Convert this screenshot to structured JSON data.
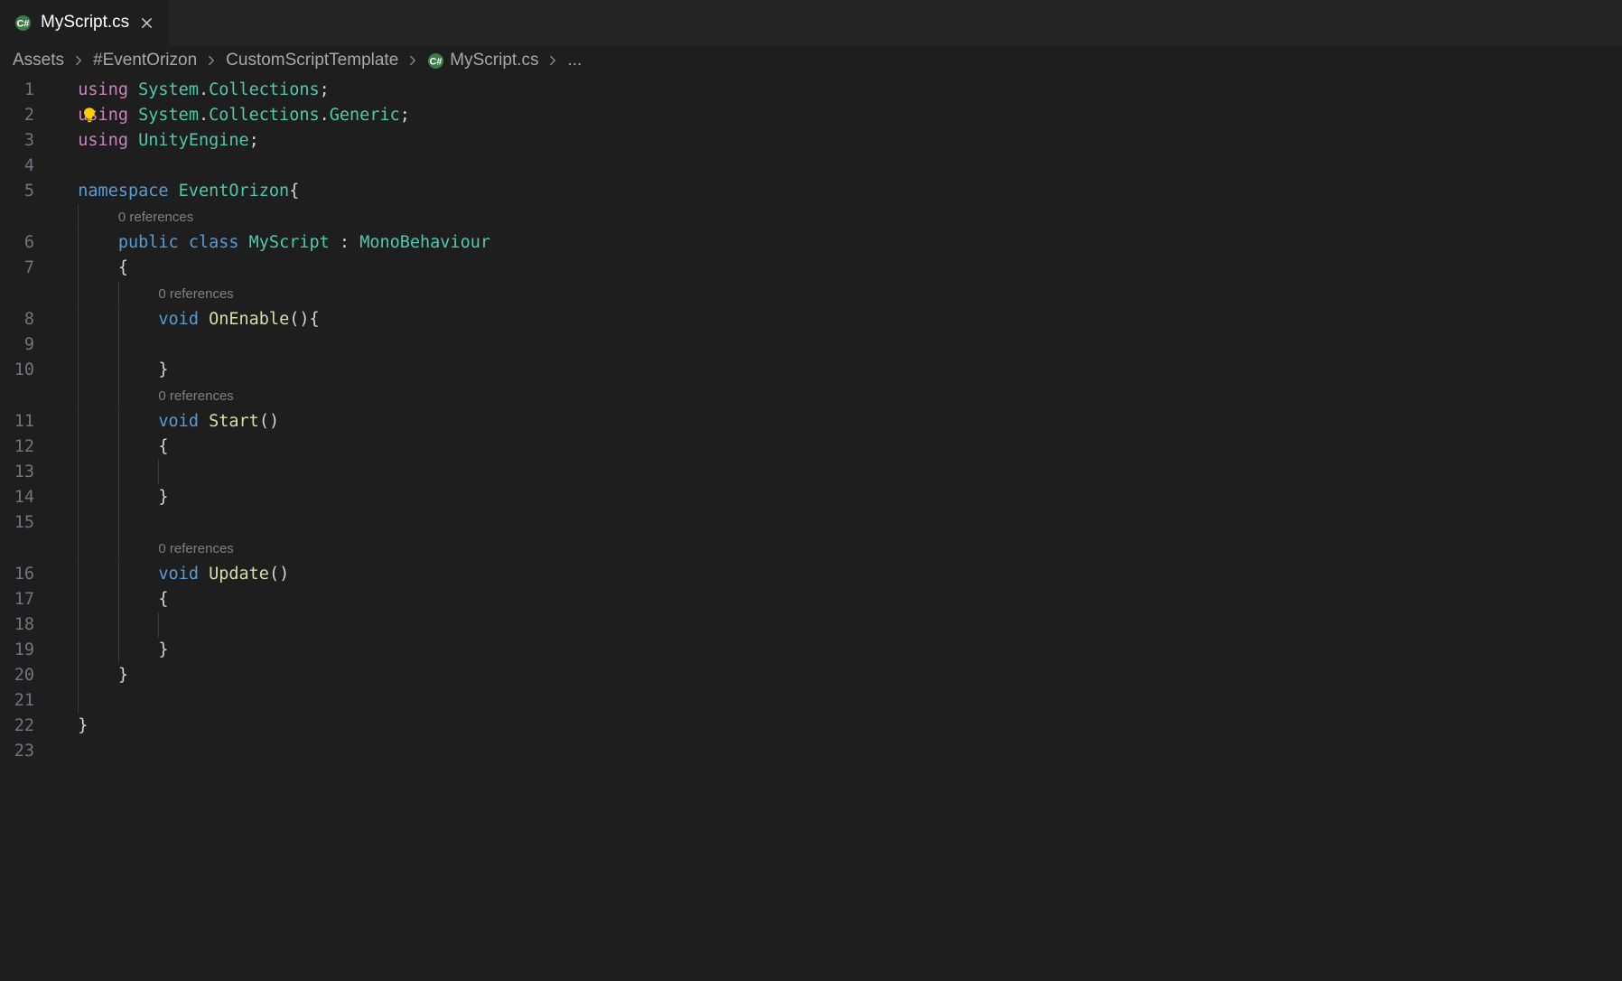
{
  "tab": {
    "label": "MyScript.cs"
  },
  "breadcrumb": {
    "seg1": "Assets",
    "seg2": "#EventOrizon",
    "seg3": "CustomScriptTemplate",
    "seg4": "MyScript.cs",
    "seg5": "..."
  },
  "codelens": {
    "class": "0 references",
    "onEnable": "0 references",
    "start": "0 references",
    "update": "0 references"
  },
  "code": {
    "l1": {
      "using": "using",
      "ns1": "System",
      "dot": ".",
      "ns2": "Collections",
      "semi": ";"
    },
    "l2": {
      "using": "using",
      "ns1": "System",
      "dot1": ".",
      "ns2": "Collections",
      "dot2": ".",
      "ns3": "Generic",
      "semi": ";"
    },
    "l3": {
      "using": "using",
      "ns1": "UnityEngine",
      "semi": ";"
    },
    "l5": {
      "kw": "namespace",
      "name": "EventOrizon",
      "brace": "{"
    },
    "l6": {
      "pub": "public",
      "cls": "class",
      "name": "MyScript",
      "colon": " : ",
      "base": "MonoBehaviour"
    },
    "l7": {
      "brace": "{"
    },
    "l8": {
      "ret": "void",
      "name": "OnEnable",
      "parens": "()",
      "brace": "{"
    },
    "l10": {
      "brace": "}"
    },
    "l11": {
      "ret": "void",
      "name": "Start",
      "parens": "()"
    },
    "l12": {
      "brace": "{"
    },
    "l14": {
      "brace": "}"
    },
    "l16": {
      "ret": "void",
      "name": "Update",
      "parens": "()"
    },
    "l17": {
      "brace": "{"
    },
    "l19": {
      "brace": "}"
    },
    "l20": {
      "brace": "}"
    },
    "l22": {
      "brace": "}"
    }
  },
  "lineNumbers": {
    "n1": "1",
    "n2": "2",
    "n3": "3",
    "n4": "4",
    "n5": "5",
    "n6": "6",
    "n7": "7",
    "n8": "8",
    "n9": "9",
    "n10": "10",
    "n11": "11",
    "n12": "12",
    "n13": "13",
    "n14": "14",
    "n15": "15",
    "n16": "16",
    "n17": "17",
    "n18": "18",
    "n19": "19",
    "n20": "20",
    "n21": "21",
    "n22": "22",
    "n23": "23"
  }
}
